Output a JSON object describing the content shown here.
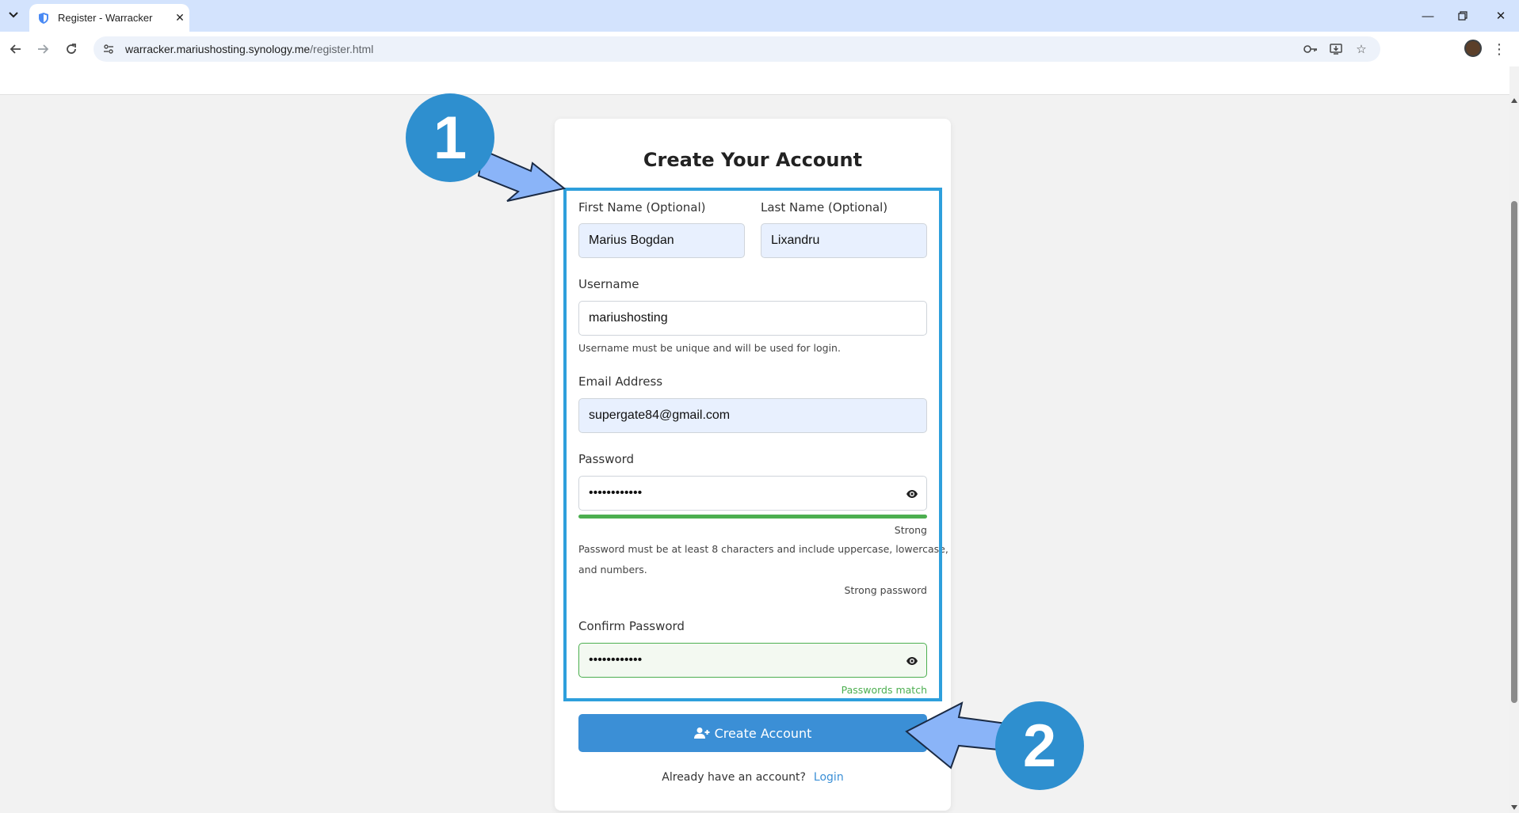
{
  "browser": {
    "tab_title": "Register - Warracker",
    "url_host": "warracker.mariushosting.synology.me",
    "url_path": "/register.html"
  },
  "form": {
    "title": "Create Your Account",
    "first_name_label": "First Name (Optional)",
    "first_name_value": "Marius Bogdan",
    "last_name_label": "Last Name (Optional)",
    "last_name_value": "Lixandru",
    "username_label": "Username",
    "username_value": "mariushosting",
    "username_help": "Username must be unique and will be used for login.",
    "email_label": "Email Address",
    "email_value": "supergate84@gmail.com",
    "password_label": "Password",
    "password_value": "••••••••••••",
    "strength_text": "Strong",
    "strength_fill": 1.0,
    "password_help_line1": "Password must be at least 8 characters and include uppercase, lowercase,",
    "password_help_line2": "and numbers.",
    "password_status": "Strong password",
    "confirm_label": "Confirm Password",
    "confirm_value": "••••••••••••",
    "match_text": "Passwords match",
    "submit_label": "Create Account",
    "login_prompt": "Already have an account?",
    "login_link": "Login"
  },
  "annotations": {
    "step1": "1",
    "step2": "2"
  },
  "colors": {
    "accent": "#3b8fd6",
    "success": "#4caf50",
    "annotation": "#2e8fcf"
  }
}
